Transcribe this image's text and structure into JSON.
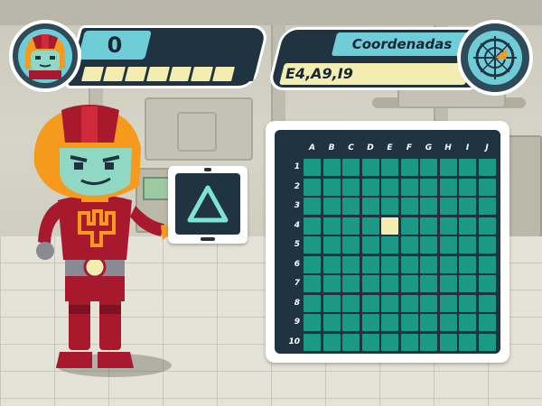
{
  "hud": {
    "score": "0",
    "progress": {
      "total_segments": 8,
      "filled_segments": 1
    },
    "coords_title": "Coordenadas",
    "coords_value": "E4,A9,I9"
  },
  "shape_card": {
    "shape": "triangle-outline",
    "color": "#7de3d3"
  },
  "grid": {
    "columns": [
      "A",
      "B",
      "C",
      "D",
      "E",
      "F",
      "G",
      "H",
      "I",
      "J"
    ],
    "rows": [
      "1",
      "2",
      "3",
      "4",
      "5",
      "6",
      "7",
      "8",
      "9",
      "10"
    ],
    "highlighted_cells": [
      "E4"
    ],
    "cell_color": "#1a9a86",
    "highlight_color": "#f3edb2",
    "frame_color": "#1f3340"
  },
  "colors": {
    "accent_cyan": "#6fcdd8",
    "panel_dark": "#1f3340",
    "progress_fill": "#f3edb2",
    "robot_red": "#a8192e",
    "robot_orange": "#f59a1c"
  }
}
